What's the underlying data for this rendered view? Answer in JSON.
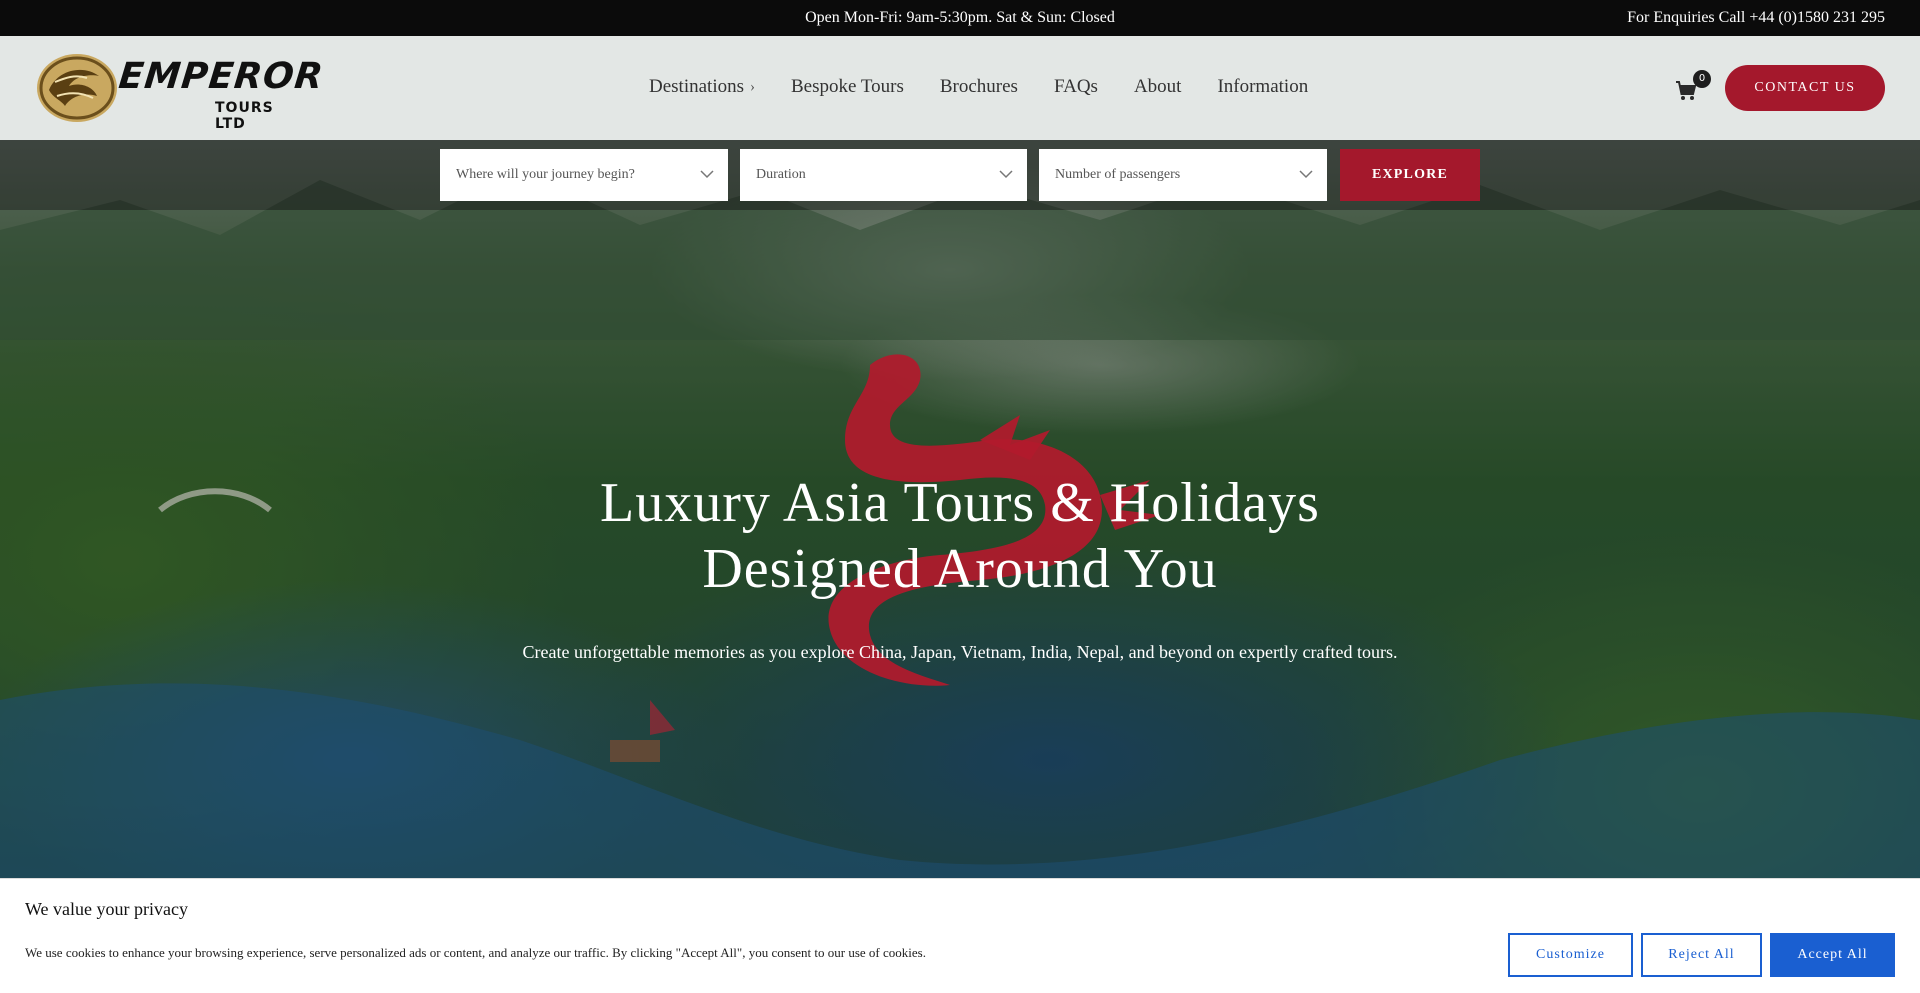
{
  "topbar": {
    "hours": "Open Mon-Fri: 9am-5:30pm. Sat & Sun: Closed",
    "phone": "For Enquiries Call +44 (0)1580 231 295"
  },
  "logo": {
    "brand": "EMPEROR",
    "sub": "TOURS LTD"
  },
  "nav": {
    "items": [
      {
        "label": "Destinations",
        "has_submenu": true
      },
      {
        "label": "Bespoke Tours"
      },
      {
        "label": "Brochures"
      },
      {
        "label": "FAQs"
      },
      {
        "label": "About"
      },
      {
        "label": "Information"
      }
    ]
  },
  "cart": {
    "count": "0",
    "icon": "shopping-cart-icon"
  },
  "contact_button": "CONTACT US",
  "search": {
    "journey_placeholder": "Where will your journey begin?",
    "duration_placeholder": "Duration",
    "passengers_placeholder": "Number of passengers",
    "explore_label": "EXPLORE"
  },
  "hero": {
    "headline_line1": "Luxury Asia Tours & Holidays",
    "headline_line2": "Designed Around You",
    "subline": "Create unforgettable memories as you explore China, Japan, Vietnam, India, Nepal, and beyond on expertly crafted tours."
  },
  "cookie": {
    "title": "We value your privacy",
    "text": "We use cookies to enhance your browsing experience, serve personalized ads or content, and analyze our traffic. By clicking \"Accept All\", you consent to our use of cookies.",
    "customize": "Customize",
    "reject": "Reject All",
    "accept": "Accept All"
  },
  "colors": {
    "brand_red": "#a4182c",
    "cookie_blue": "#1a5fd1",
    "topbar_bg": "#0b0b0b"
  }
}
